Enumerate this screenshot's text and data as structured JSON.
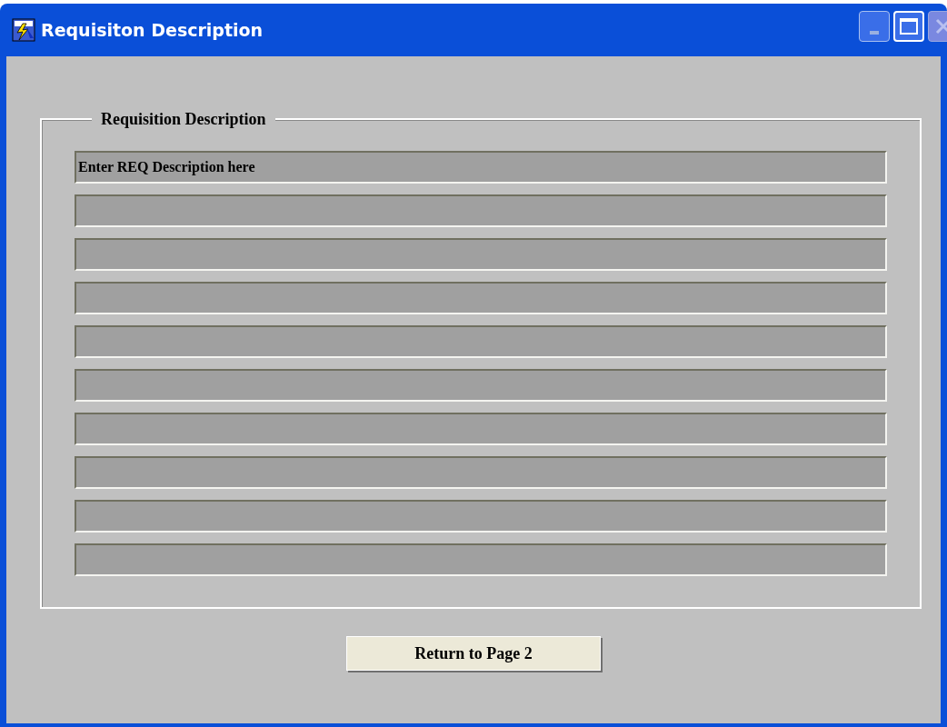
{
  "window": {
    "title": "Requisiton Description"
  },
  "group": {
    "legend": "Requisition Description",
    "lines": [
      {
        "kind": "field",
        "value": "Enter REQ Description here"
      },
      {
        "kind": "field"
      },
      {
        "kind": "field"
      },
      {
        "kind": "field"
      },
      {
        "kind": "field"
      },
      {
        "kind": "field"
      },
      {
        "kind": "field"
      },
      {
        "kind": "field"
      },
      {
        "kind": "field"
      },
      {
        "kind": "field"
      }
    ]
  },
  "buttons": [
    {
      "label": "Return to Page 2"
    }
  ]
}
